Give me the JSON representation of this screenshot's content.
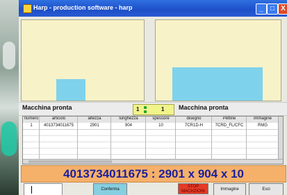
{
  "window": {
    "title": "Harp - production software - harp",
    "controls": {
      "min": "_",
      "max": "□",
      "close": "X"
    }
  },
  "panels": [
    {
      "name": "left-view",
      "level": 0.27
    },
    {
      "name": "right-view",
      "level": 0.41
    }
  ],
  "status": {
    "left": "Macchina pronta",
    "right": "Macchina pronta",
    "counter_left": "1",
    "counter_right": "1"
  },
  "table": {
    "columns": [
      "numero",
      "articolo",
      "altezza",
      "lunghezza",
      "spessore",
      "disegno",
      "Pettine",
      "immagine"
    ],
    "rows": [
      [
        "1",
        "4013734011675",
        "2901",
        "904",
        "10",
        "7CR1D-H",
        "7CRD_FL/CFC",
        "RMG"
      ]
    ]
  },
  "banner": {
    "code": "4013734011675",
    "separator": ":",
    "dims": "2901 x 904 x 10"
  },
  "buttons": {
    "conferma": "Conferma",
    "stop_line1": "STOP",
    "stop_line2": "MACHZIONI",
    "immagine": "Immagine",
    "esci": "Esci"
  },
  "colors": {
    "titlebar": "#1d4fc8",
    "panel_bg": "#f7f2c8",
    "bar": "#7fd2ec",
    "banner_bg": "#f5b06a",
    "banner_text": "#1a1fa0",
    "stop": "#e43a26"
  }
}
